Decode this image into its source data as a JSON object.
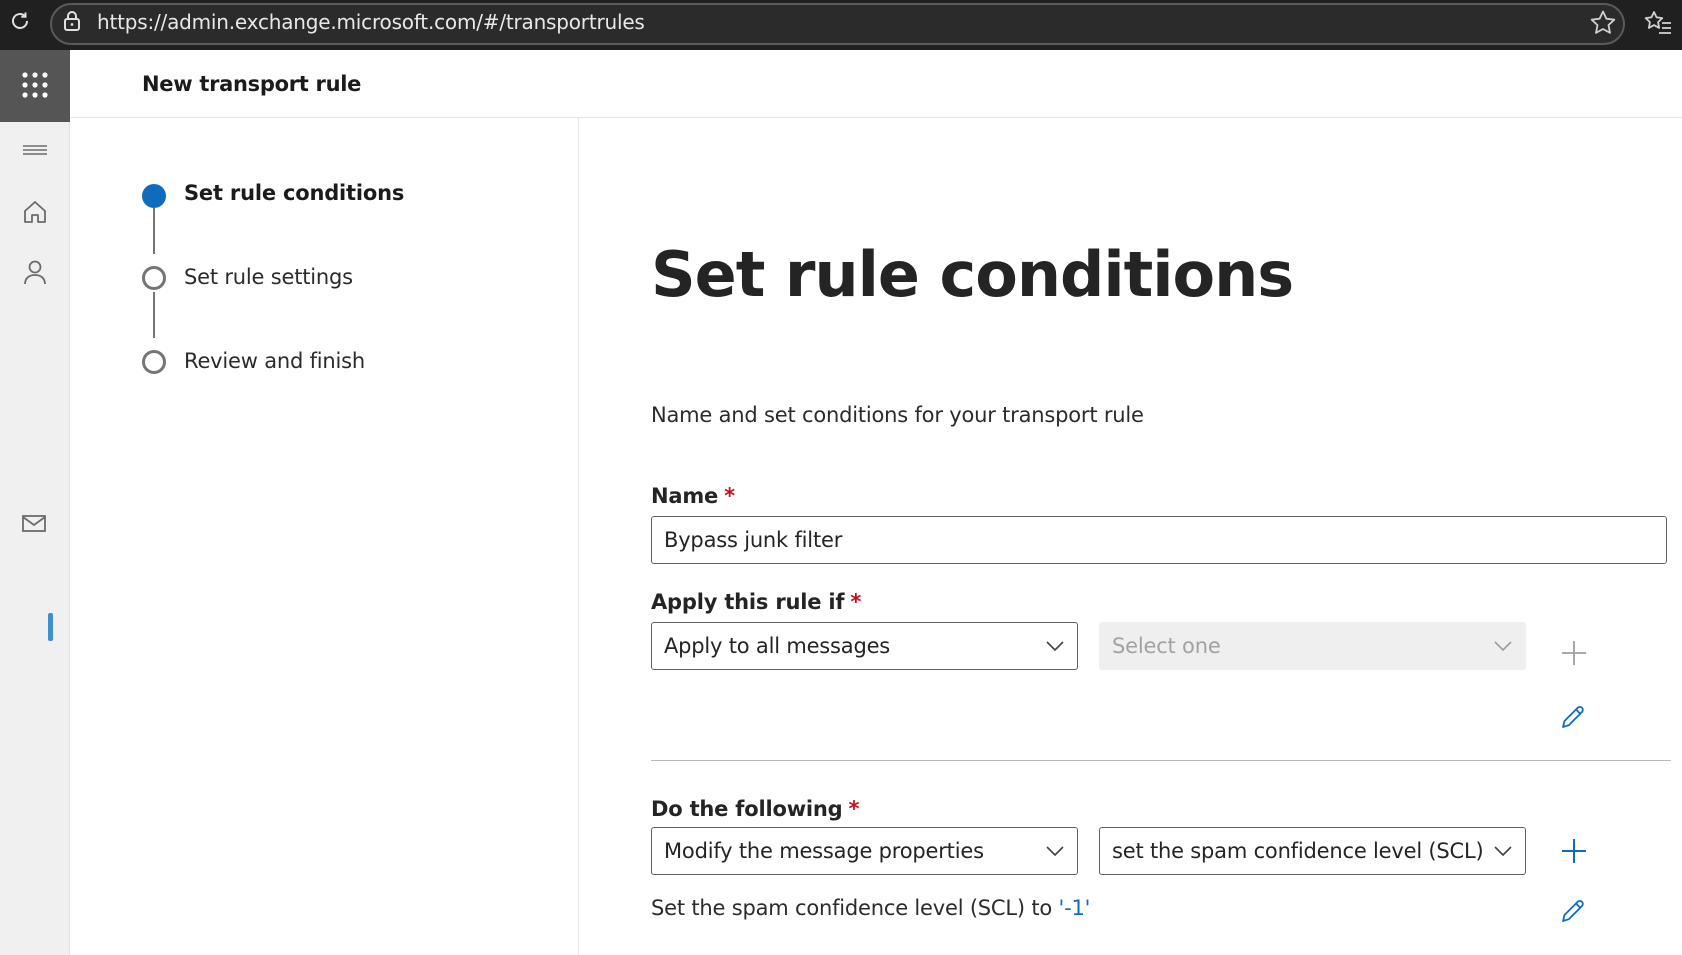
{
  "browser": {
    "url": "https://admin.exchange.microsoft.com/#/transportrules"
  },
  "rail": {
    "icons": [
      "app-launcher-icon",
      "hamburger-menu-icon",
      "home-icon",
      "person-icon",
      "mail-icon"
    ]
  },
  "header": {
    "title": "New transport rule"
  },
  "steps": [
    {
      "label": "Set rule conditions",
      "state": "active"
    },
    {
      "label": "Set rule settings",
      "state": "todo"
    },
    {
      "label": "Review and finish",
      "state": "todo"
    }
  ],
  "main": {
    "title": "Set rule conditions",
    "subtitle": "Name and set conditions for your transport rule",
    "name": {
      "label": "Name",
      "required_mark": "*",
      "value": "Bypass junk filter"
    },
    "apply_if": {
      "label": "Apply this rule if",
      "required_mark": "*",
      "condition_value": "Apply to all messages",
      "sub_condition_placeholder": "Select one"
    },
    "do_following": {
      "label": "Do the following",
      "required_mark": "*",
      "action_value": "Modify the message properties",
      "sub_action_value": "set the spam confidence level (SCL)",
      "summary_prefix": "Set the spam confidence level (SCL) to",
      "summary_value": "'-1'"
    }
  },
  "colors": {
    "accent": "#0f6cbd",
    "required": "#c50f1f",
    "browser_bar": "#202020",
    "rail_bg": "#f0f0f0"
  }
}
